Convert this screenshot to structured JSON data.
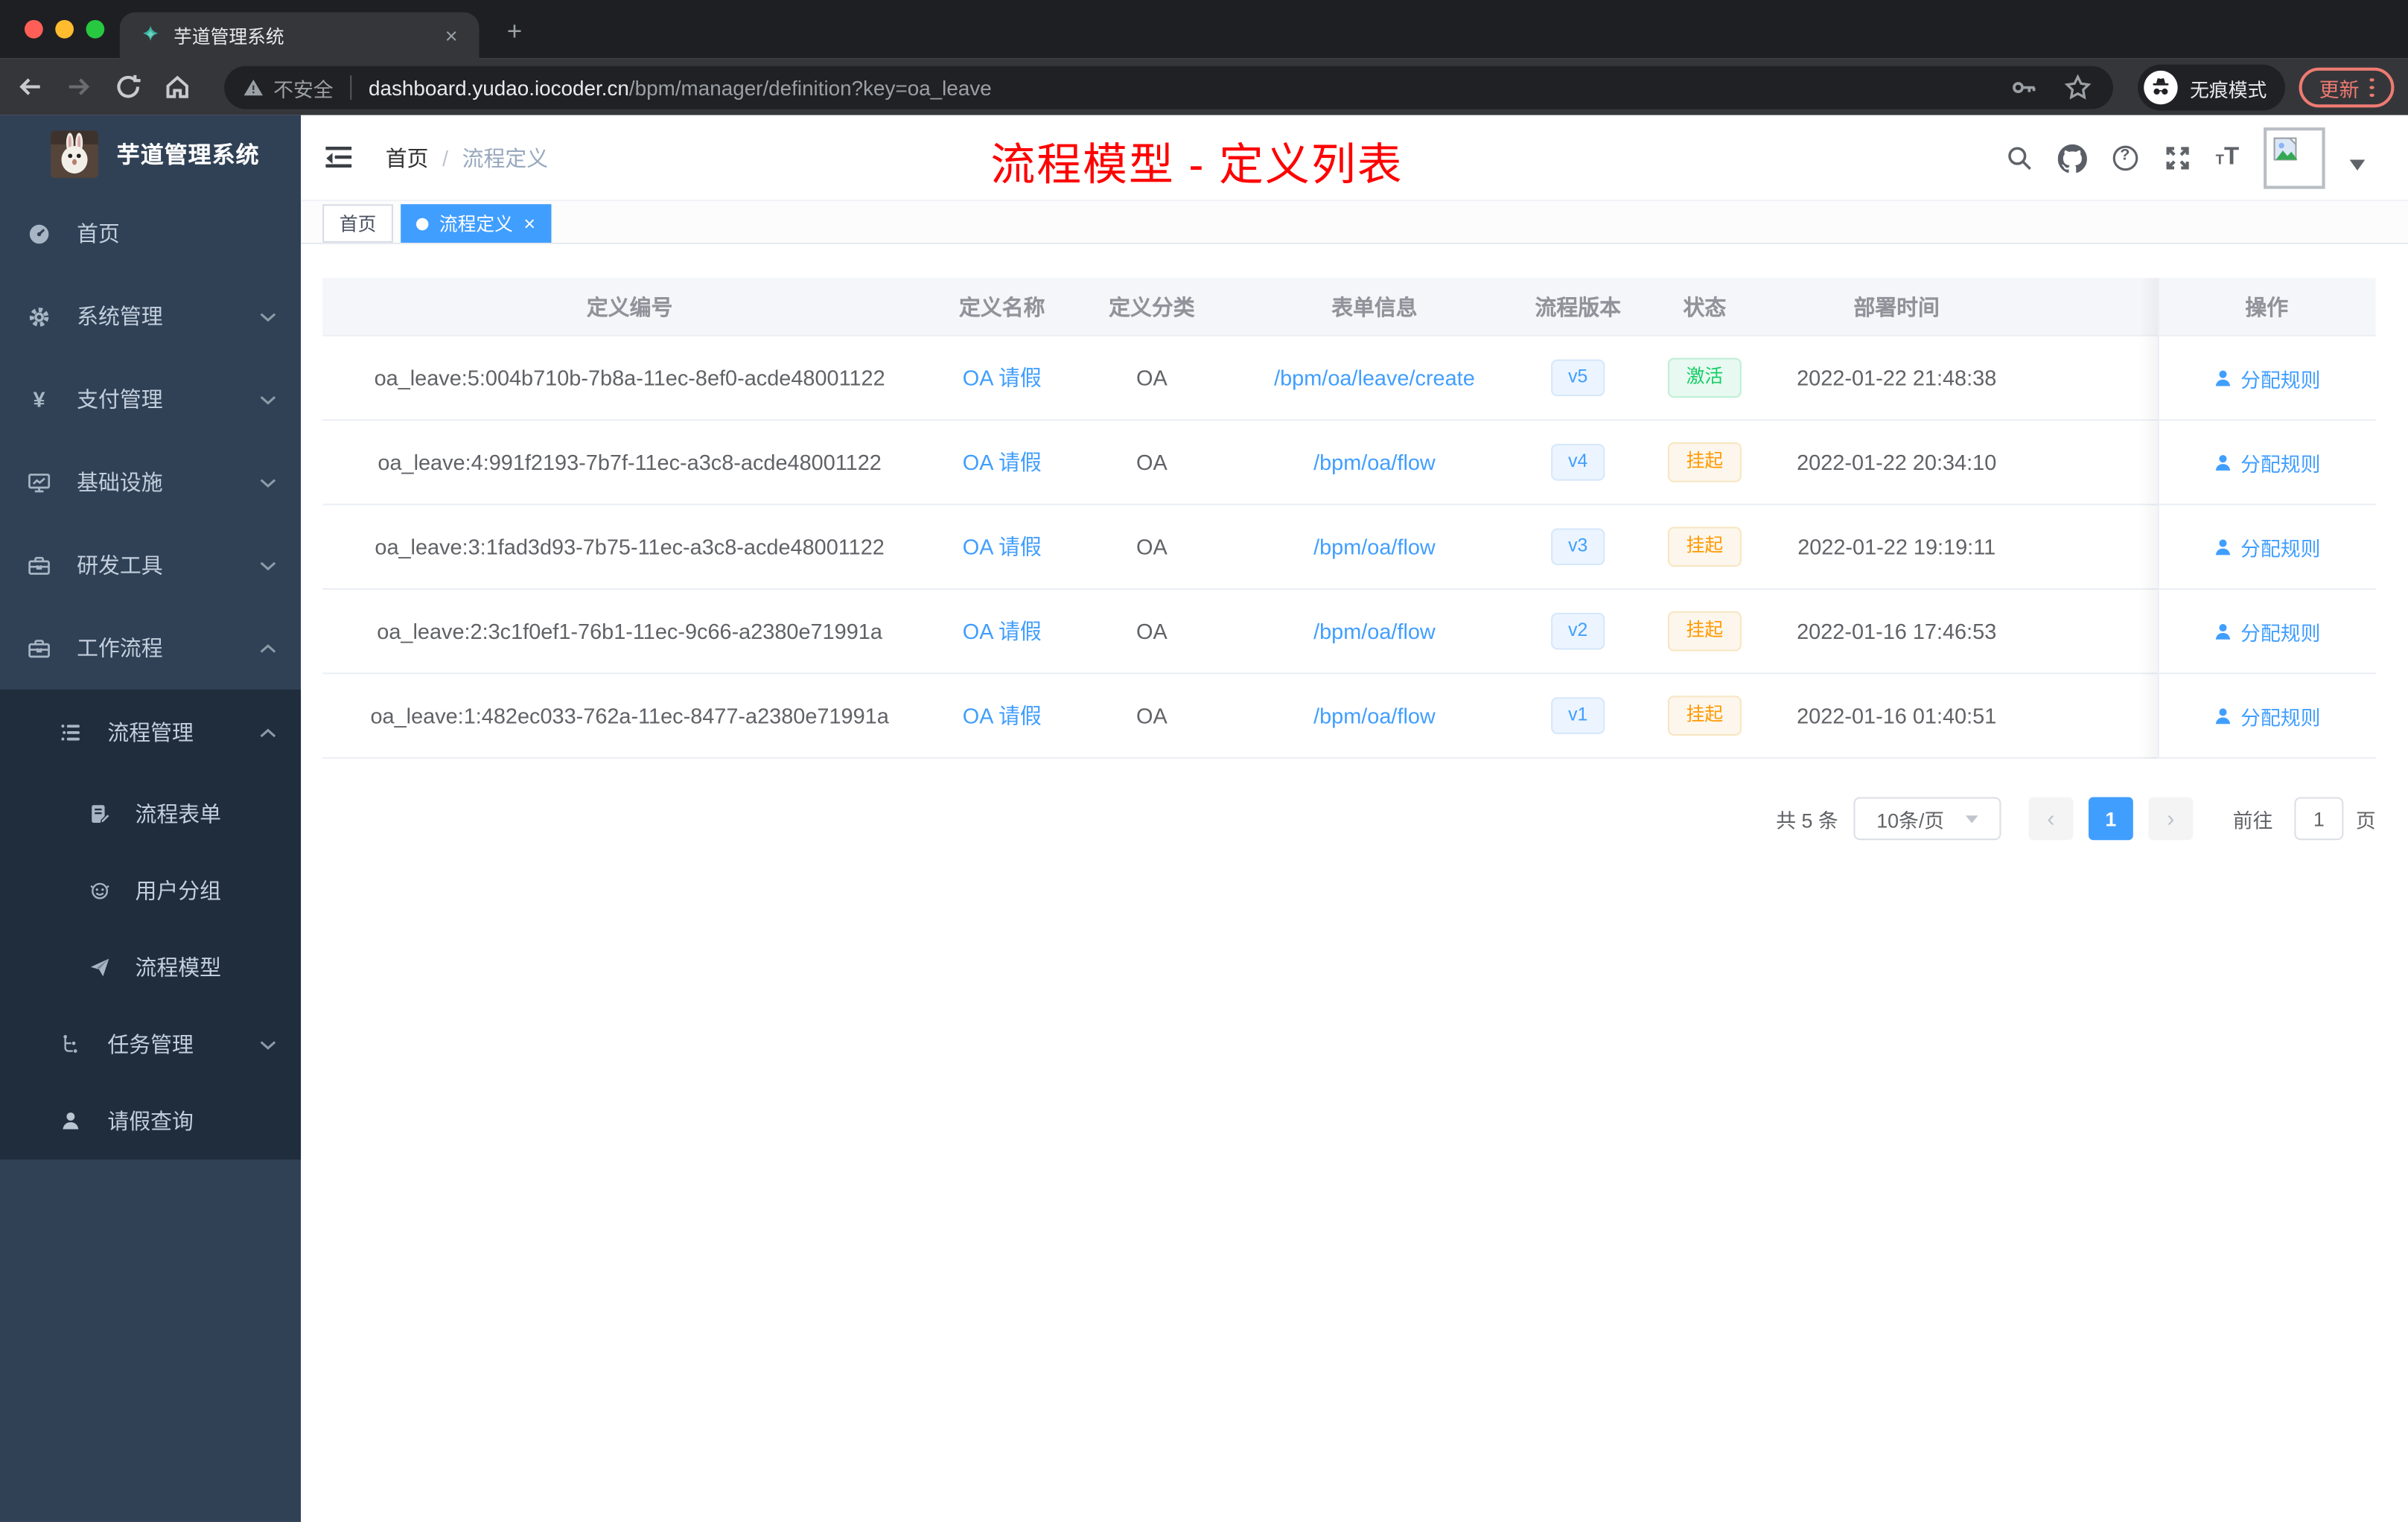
{
  "browser": {
    "tab": {
      "title": "芋道管理系统"
    },
    "address": {
      "security_label": "不安全",
      "host": "dashboard.yudao.iocoder.cn",
      "path": "/bpm/manager/definition?key=oa_leave"
    },
    "incognito_label": "无痕模式",
    "update_button": "更新"
  },
  "glyphs": {
    "close": "×",
    "plus": "+",
    "prev": "‹",
    "next": "›",
    "question": "?",
    "yen": "¥",
    "font_small": "T",
    "font_big": "T"
  },
  "sidebar": {
    "logo_title": "芋道管理系统",
    "menu": [
      {
        "label": "首页",
        "icon": "dashboard-icon"
      },
      {
        "label": "系统管理",
        "icon": "gear-icon"
      },
      {
        "label": "支付管理",
        "icon": "yen-icon"
      },
      {
        "label": "基础设施",
        "icon": "monitor-icon"
      },
      {
        "label": "研发工具",
        "icon": "toolbox-icon"
      },
      {
        "label": "工作流程",
        "icon": "briefcase-icon"
      }
    ],
    "workflow_submenu": {
      "process_group": {
        "label": "流程管理"
      },
      "children": [
        {
          "label": "流程表单",
          "icon": "form-icon"
        },
        {
          "label": "用户分组",
          "icon": "robot-icon"
        },
        {
          "label": "流程模型",
          "icon": "paper-plane-icon"
        }
      ],
      "task_group": {
        "label": "任务管理"
      },
      "leave_item": {
        "label": "请假查询"
      }
    }
  },
  "navbar": {
    "breadcrumb": {
      "home": "首页",
      "separator": "/",
      "current": "流程定义"
    },
    "watermark_title": "流程模型 - 定义列表"
  },
  "tags_view": [
    {
      "label": "首页"
    },
    {
      "label": "流程定义"
    }
  ],
  "table": {
    "columns": [
      "定义编号",
      "定义名称",
      "定义分类",
      "表单信息",
      "流程版本",
      "状态",
      "部署时间",
      "操作"
    ],
    "rows": [
      {
        "id": "oa_leave:5:004b710b-7b8a-11ec-8ef0-acde48001122",
        "name": "OA 请假",
        "category": "OA",
        "form": "/bpm/oa/leave/create",
        "version": "v5",
        "status": "激活",
        "status_type": "success",
        "deploy_time": "2022-01-22 21:48:38",
        "action": "分配规则"
      },
      {
        "id": "oa_leave:4:991f2193-7b7f-11ec-a3c8-acde48001122",
        "name": "OA 请假",
        "category": "OA",
        "form": "/bpm/oa/flow",
        "version": "v4",
        "status": "挂起",
        "status_type": "warning",
        "deploy_time": "2022-01-22 20:34:10",
        "action": "分配规则"
      },
      {
        "id": "oa_leave:3:1fad3d93-7b75-11ec-a3c8-acde48001122",
        "name": "OA 请假",
        "category": "OA",
        "form": "/bpm/oa/flow",
        "version": "v3",
        "status": "挂起",
        "status_type": "warning",
        "deploy_time": "2022-01-22 19:19:11",
        "action": "分配规则"
      },
      {
        "id": "oa_leave:2:3c1f0ef1-76b1-11ec-9c66-a2380e71991a",
        "name": "OA 请假",
        "category": "OA",
        "form": "/bpm/oa/flow",
        "version": "v2",
        "status": "挂起",
        "status_type": "warning",
        "deploy_time": "2022-01-16 17:46:53",
        "action": "分配规则"
      },
      {
        "id": "oa_leave:1:482ec033-762a-11ec-8477-a2380e71991a",
        "name": "OA 请假",
        "category": "OA",
        "form": "/bpm/oa/flow",
        "version": "v1",
        "status": "挂起",
        "status_type": "warning",
        "deploy_time": "2022-01-16 01:40:51",
        "action": "分配规则"
      }
    ]
  },
  "pagination": {
    "total": "共 5 条",
    "page_size": "10条/页",
    "page": "1",
    "goto_prefix": "前往",
    "goto_value": "1",
    "goto_suffix": "页"
  },
  "colors": {
    "accent_blue": "#409eff",
    "success_green": "#13ce66",
    "warning_orange": "#ff9900",
    "watermark_red": "#ff0000",
    "sidebar_bg": "#304156",
    "submenu_bg": "#1f2d3d",
    "update_red": "#ee7b72"
  }
}
